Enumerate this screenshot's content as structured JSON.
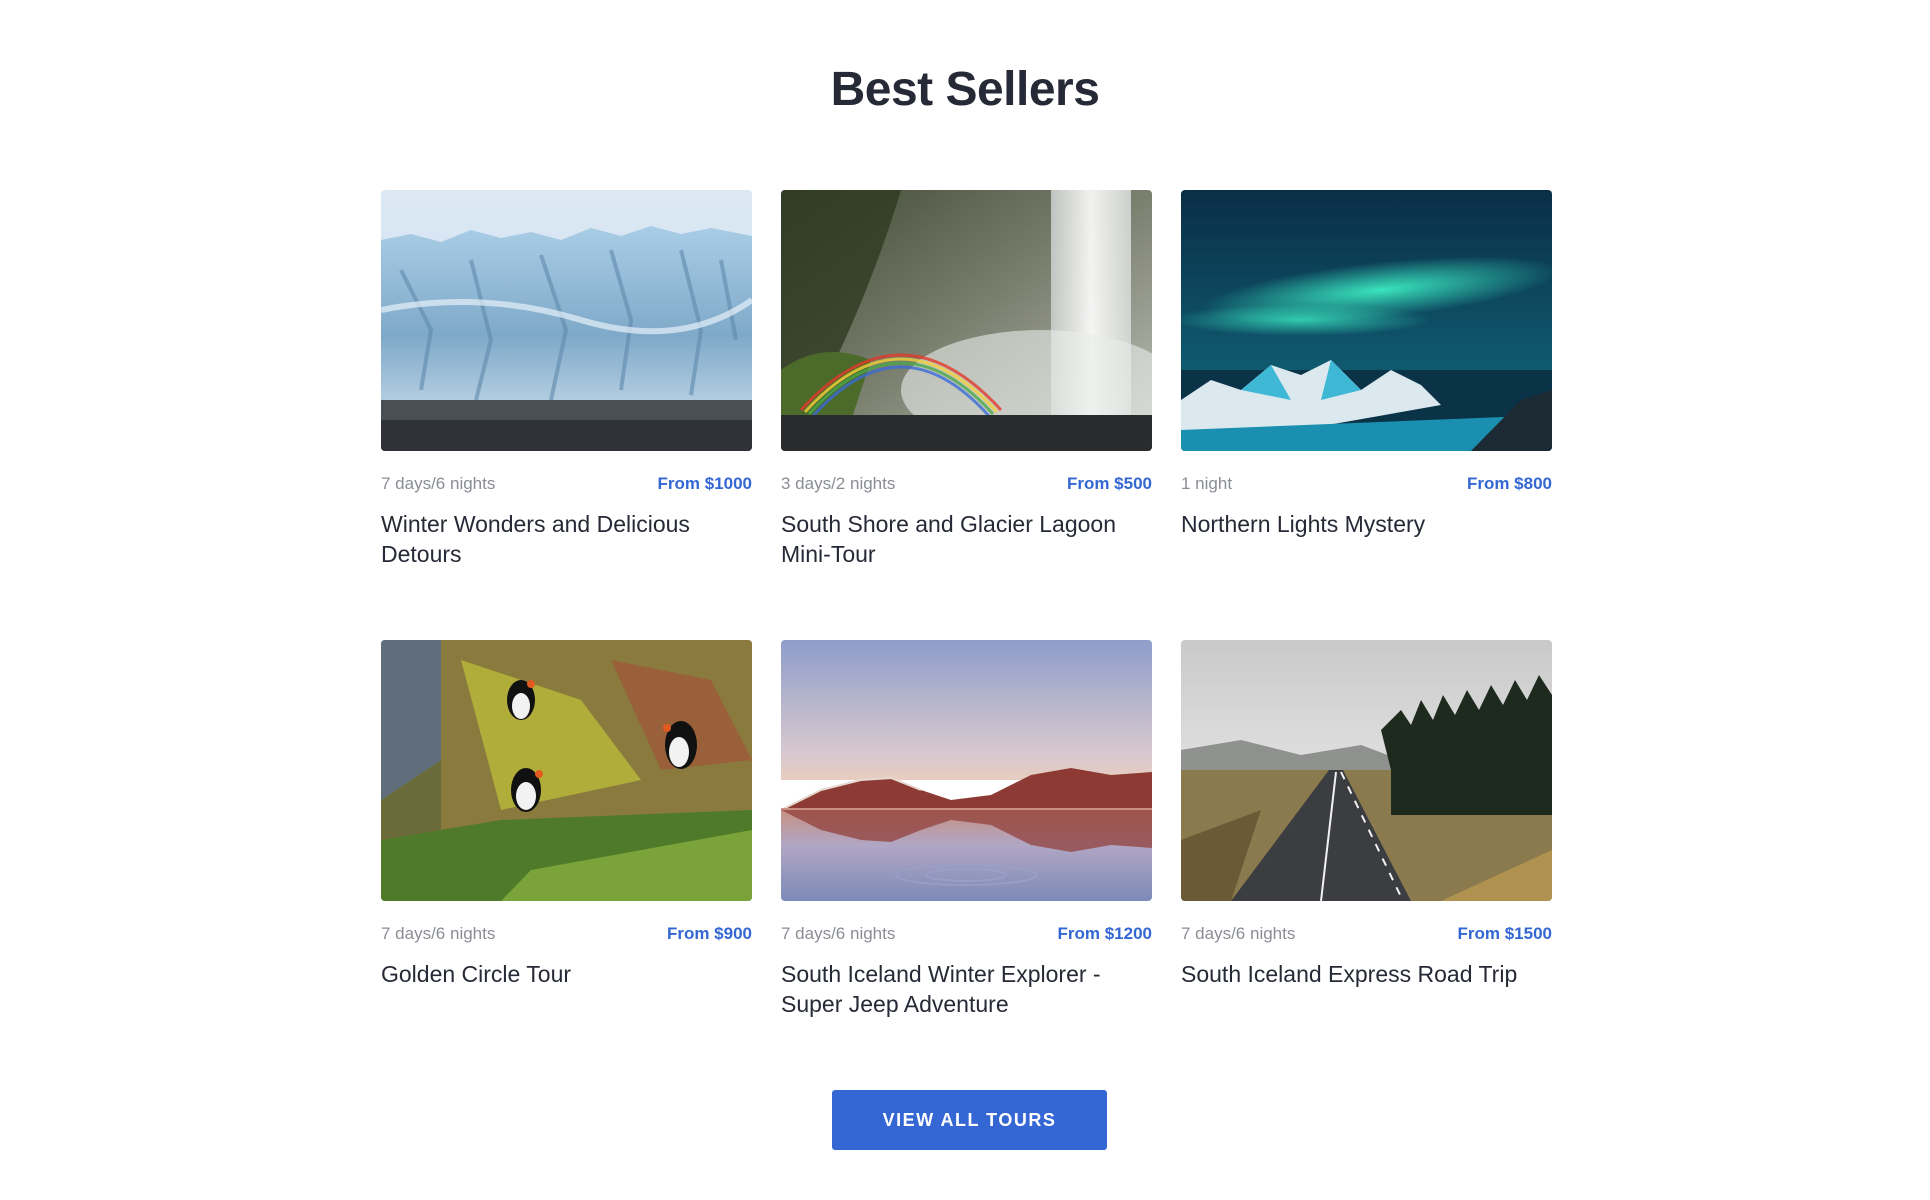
{
  "section": {
    "title": "Best Sellers"
  },
  "tours": [
    {
      "duration": "7 days/6 nights",
      "price": "From $1000",
      "title": "Winter Wonders and Delicious Detours",
      "image": "glacier-photo"
    },
    {
      "duration": "3 days/2 nights",
      "price": "From $500",
      "title": "South Shore and Glacier Lagoon Mini-Tour",
      "image": "waterfall-rainbow-photo"
    },
    {
      "duration": "1 night",
      "price": "From $800",
      "title": "Northern Lights Mystery",
      "image": "northern-lights-photo"
    },
    {
      "duration": "7 days/6 nights",
      "price": "From $900",
      "title": "Golden Circle Tour",
      "image": "puffins-photo"
    },
    {
      "duration": "7 days/6 nights",
      "price": "From $1200",
      "title": "South Iceland Winter Explorer -Super Jeep Adventure",
      "image": "mountain-lake-reflection-photo"
    },
    {
      "duration": "7 days/6 nights",
      "price": "From $1500",
      "title": "South Iceland Express Road Trip",
      "image": "road-forest-photo"
    }
  ],
  "cta": {
    "label": "VIEW ALL TOURS"
  },
  "colors": {
    "accent": "#3467d4",
    "title": "#262a36",
    "muted": "#8a8d95"
  }
}
